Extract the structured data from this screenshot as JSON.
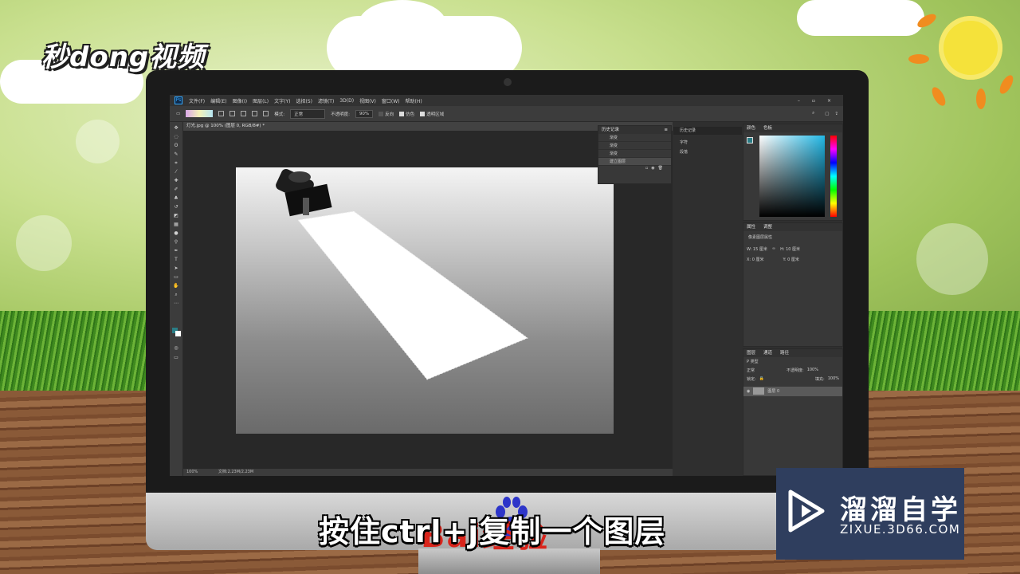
{
  "watermark_logo": "秒dong视频",
  "subtitle": "按住ctrl+j复制一个图层",
  "baidu_overlay": "Bai经验",
  "brand": {
    "name": "溜溜自学",
    "url": "ZIXUE.3D66.COM"
  },
  "photoshop": {
    "menu": [
      "文件(F)",
      "编辑(E)",
      "图像(I)",
      "图层(L)",
      "文字(Y)",
      "选择(S)",
      "滤镜(T)",
      "3D(D)",
      "视图(V)",
      "窗口(W)",
      "帮助(H)"
    ],
    "options": {
      "mode_label": "模式:",
      "mode_value": "正常",
      "opacity_label": "不透明度:",
      "opacity_value": "90%",
      "reverse": "反向",
      "dither": "仿色",
      "transparency": "透明区域"
    },
    "doc_tab": "灯光.jpg @ 100% (图层 0, RGB/8#) *",
    "status": {
      "zoom": "100%",
      "doc": "文档:2.23M/2.23M"
    },
    "history": {
      "tab": "历史记录",
      "items": [
        "渐变",
        "渐变",
        "渐变",
        "建立图层"
      ]
    },
    "mini_panel": {
      "items": [
        "历史记录",
        "字符",
        "段落"
      ]
    },
    "color_panel": {
      "tabs": [
        "颜色",
        "色板"
      ]
    },
    "properties": {
      "tabs": [
        "属性",
        "调整"
      ],
      "title": "像素图层属性",
      "w": "W: 15 厘米",
      "h": "H: 10 厘米",
      "x": "X: 0 厘米",
      "y": "Y: 0 厘米"
    },
    "layers": {
      "tabs": [
        "图层",
        "通道",
        "路径"
      ],
      "filter": "P 类型",
      "blend": "正常",
      "opacity_label": "不透明度:",
      "opacity": "100%",
      "lock_label": "锁定:",
      "fill_label": "填充:",
      "fill": "100%",
      "layer_name": "图层 0"
    }
  }
}
